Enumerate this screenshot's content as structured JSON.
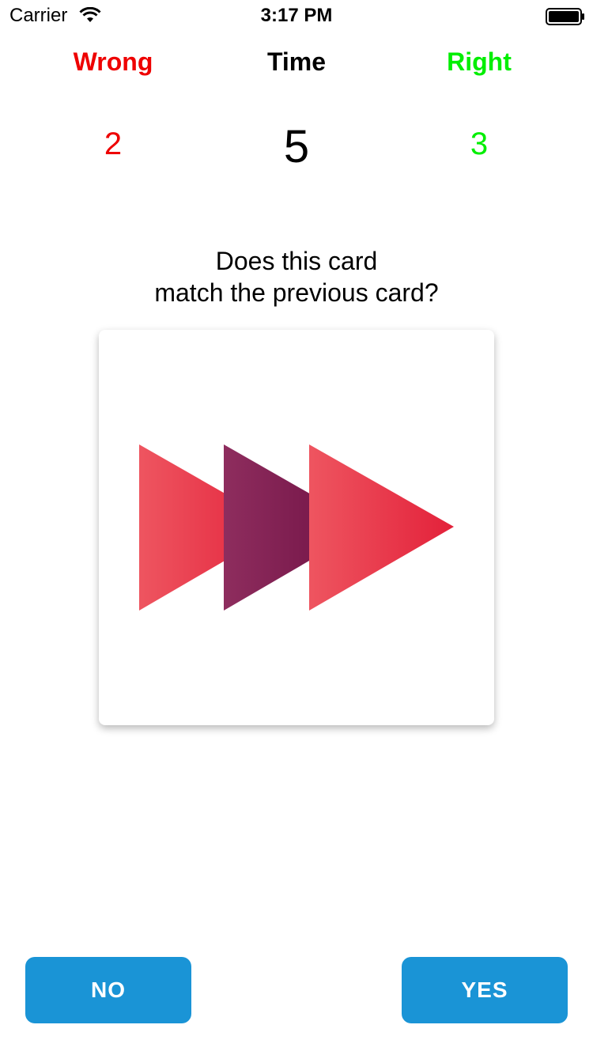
{
  "status_bar": {
    "carrier": "Carrier",
    "time": "3:17 PM",
    "icons": [
      "wifi-icon",
      "battery-icon"
    ]
  },
  "scoreboard": {
    "wrong_label": "Wrong",
    "time_label": "Time",
    "right_label": "Right",
    "wrong_count": "2",
    "time_remaining": "5",
    "right_count": "3"
  },
  "question": {
    "line1": "Does this card",
    "line2": "match the previous card?"
  },
  "card": {
    "shape": "triangle",
    "count": 3,
    "colors": [
      "#e8414f",
      "#7a1a4e",
      "#e8414f"
    ]
  },
  "buttons": {
    "no_label": "NO",
    "yes_label": "YES"
  },
  "colors": {
    "wrong": "#ee0000",
    "right": "#00ee00",
    "button": "#1a94d6"
  }
}
